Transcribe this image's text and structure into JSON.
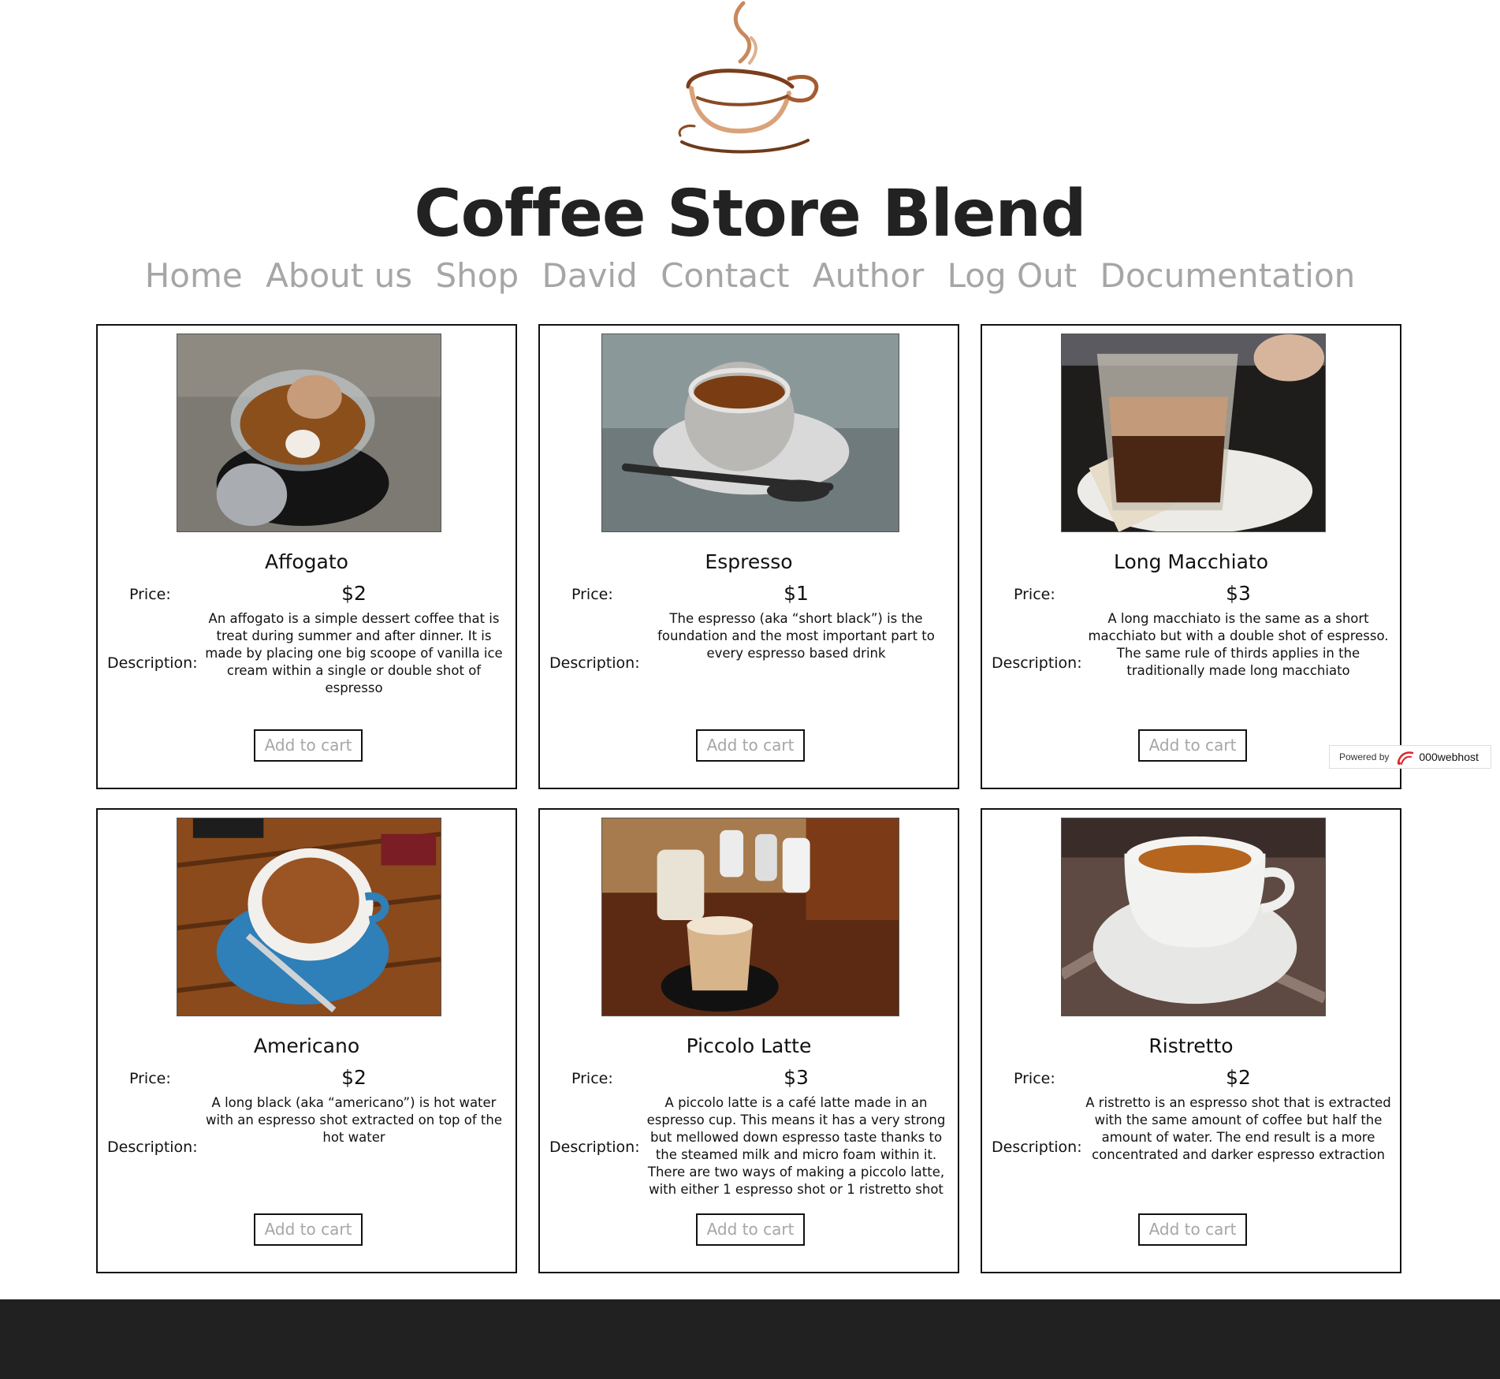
{
  "site": {
    "title": "Coffee Store Blend",
    "logo_icon": "coffee-cup-logo-icon"
  },
  "nav": [
    "Home",
    "About us",
    "Shop",
    "David",
    "Contact",
    "Author",
    "Log Out",
    "Documentation"
  ],
  "labels": {
    "price": "Price:",
    "description": "Description:",
    "add_to_cart": "Add to cart"
  },
  "products": [
    {
      "name": "Affogato",
      "price": "$2",
      "image_icon": "affogato-photo",
      "description": "An affogato is a simple dessert coffee that is treat during summer and after dinner. It is made by placing one big scoope of vanilla ice cream within a single or double shot of espresso"
    },
    {
      "name": "Espresso",
      "price": "$1",
      "image_icon": "espresso-photo",
      "description": "The espresso (aka “short black”) is the foundation and the most important part to every espresso based drink"
    },
    {
      "name": "Long Macchiato",
      "price": "$3",
      "image_icon": "long-macchiato-photo",
      "description": "A long macchiato is the same as a short macchiato but with a double shot of espresso. The same rule of thirds applies in the traditionally made long macchiato"
    },
    {
      "name": "Americano",
      "price": "$2",
      "image_icon": "americano-photo",
      "description": "A long black (aka “americano”) is hot water with an espresso shot extracted on top of the hot water"
    },
    {
      "name": "Piccolo Latte",
      "price": "$3",
      "image_icon": "piccolo-latte-photo",
      "description": "A piccolo latte is a café latte made in an espresso cup. This means it has a very strong but mellowed down espresso taste thanks to the steamed milk and micro foam within it. There are two ways of making a piccolo latte, with either 1 espresso shot or 1 ristretto shot"
    },
    {
      "name": "Ristretto",
      "price": "$2",
      "image_icon": "ristretto-photo",
      "description": "A ristretto is an espresso shot that is extracted with the same amount of coffee but half the amount of water. The end result is a more concentrated and darker espresso extraction"
    }
  ],
  "badge": {
    "prefix": "Powered by",
    "brand": "000webhost"
  },
  "colors": {
    "nav": "#a6a6a6",
    "title": "#222222",
    "footer": "#212121",
    "logo_brown": "#8a4a24",
    "logo_light": "#d9a27a"
  }
}
